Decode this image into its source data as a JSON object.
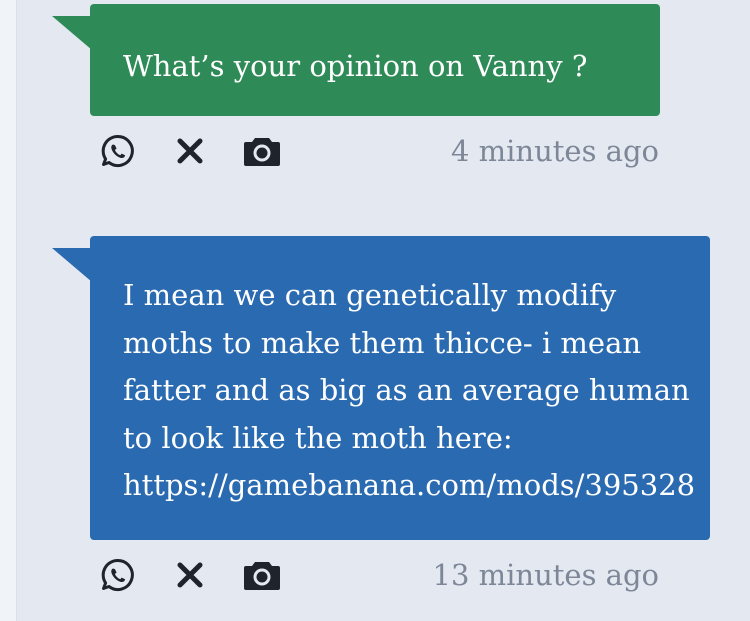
{
  "messages": [
    {
      "text": "What’s your opinion on Vanny ?",
      "color": "#2e8b57",
      "timestamp": "4 minutes ago",
      "actions": [
        "whatsapp-icon",
        "close-icon",
        "camera-icon"
      ]
    },
    {
      "text": "I mean we can genetically modify\nmoths to make them thicce- i mean\nfatter and as big as an average human\nto look like the moth here:\nhttps://gamebanana.com/mods/395328",
      "color": "#2a6ab0",
      "timestamp": "13 minutes ago",
      "actions": [
        "whatsapp-icon",
        "close-icon",
        "camera-icon"
      ]
    }
  ]
}
